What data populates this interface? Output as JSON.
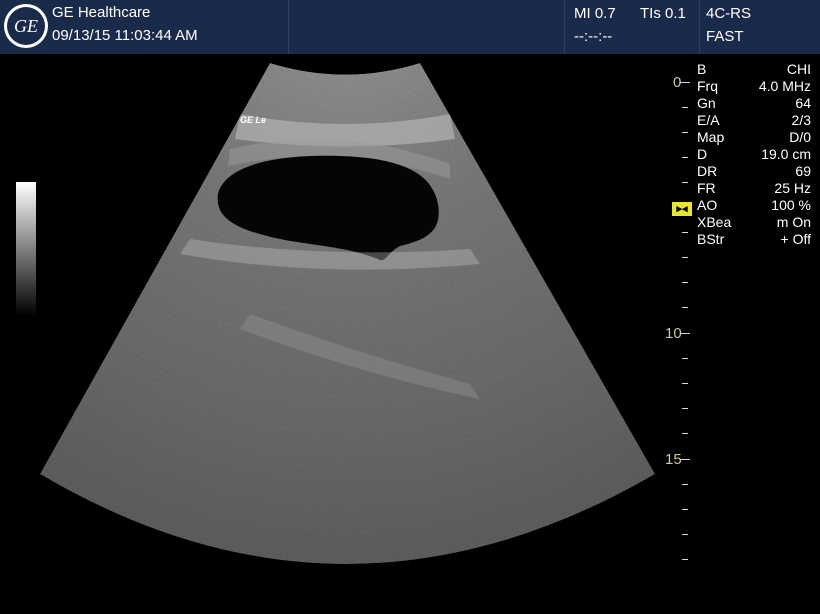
{
  "header": {
    "brand": "GE Healthcare",
    "datetime": "09/13/15 11:03:44 AM",
    "mi": "MI 0.7",
    "tis": "TIs 0.1",
    "probe": "4C-RS",
    "preset": "FAST",
    "placeholder": "--:--:--",
    "logo_text": "GE"
  },
  "probe_mark": "GE Le",
  "params": [
    {
      "key": "B",
      "value": "CHI"
    },
    {
      "key": "Frq",
      "value": "4.0 MHz"
    },
    {
      "key": "Gn",
      "value": "64"
    },
    {
      "key": "E/A",
      "value": "2/3"
    },
    {
      "key": "Map",
      "value": "D/0"
    },
    {
      "key": "D",
      "value": "19.0 cm"
    },
    {
      "key": "DR",
      "value": "69"
    },
    {
      "key": "FR",
      "value": "25 Hz"
    },
    {
      "key": "AO",
      "value": "100 %"
    },
    {
      "key": "XBea",
      "value": "m On"
    },
    {
      "key": "BStr",
      "value": "+ Off"
    }
  ],
  "depth_labels": [
    "0",
    "10",
    "15"
  ],
  "colors": {
    "header_bg": "#1a2a4a",
    "ruler_label": "#c9c99a",
    "focus_marker": "#e6e62a"
  }
}
